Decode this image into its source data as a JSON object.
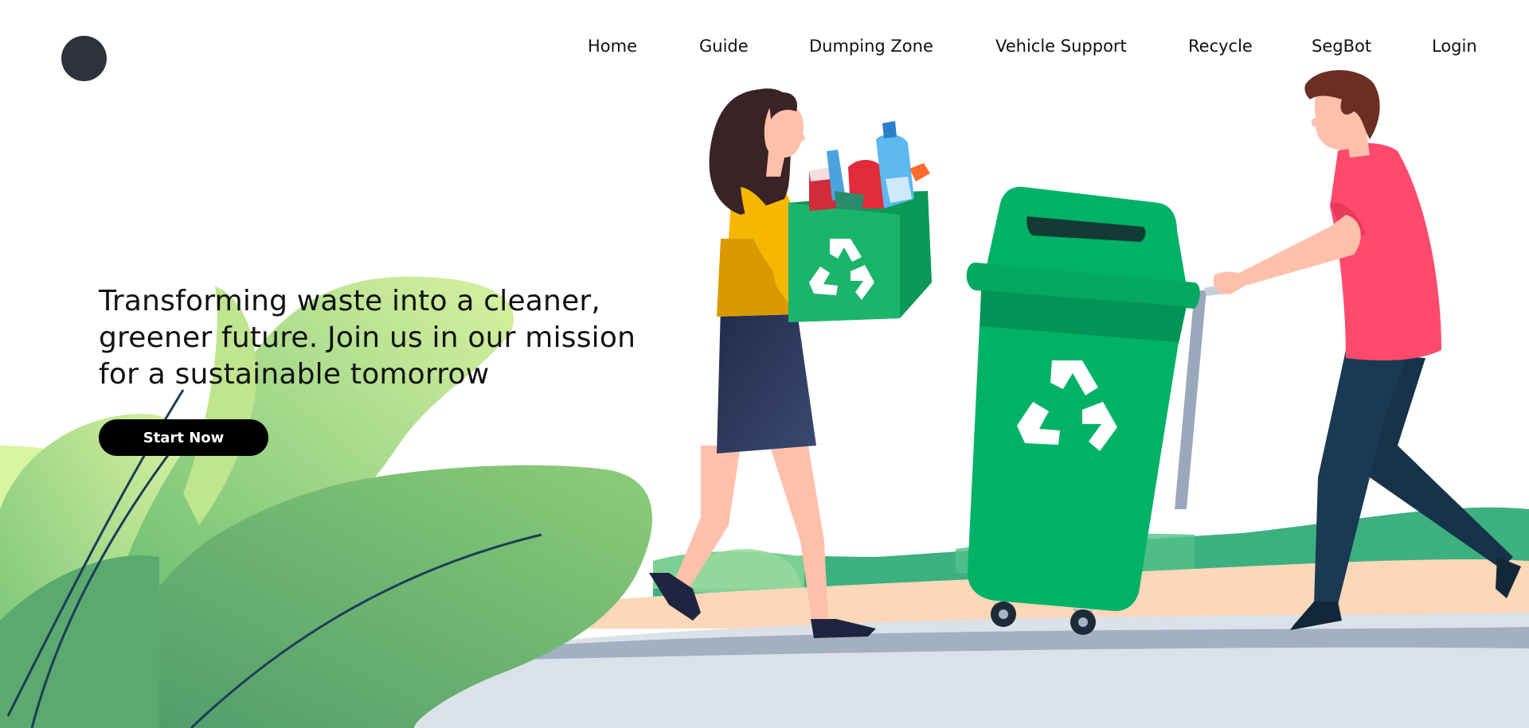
{
  "nav": {
    "items": [
      {
        "label": "Home"
      },
      {
        "label": "Guide"
      },
      {
        "label": "Dumping Zone"
      },
      {
        "label": "Vehicle Support"
      },
      {
        "label": "Recycle"
      },
      {
        "label": "SegBot"
      },
      {
        "label": "Login"
      }
    ]
  },
  "hero": {
    "lines": [
      "Transforming waste into a cleaner,",
      "greener future. Join us in our mission",
      "for a sustainable tomorrow"
    ],
    "cta_label": "Start Now"
  },
  "colors": {
    "bin_green": "#02b366",
    "leaf_green": "#7cc576",
    "shirt_pink": "#ff4a6e",
    "sweater_yellow": "#f6b700",
    "navy": "#16334a",
    "logo_dark": "#2e333b"
  }
}
